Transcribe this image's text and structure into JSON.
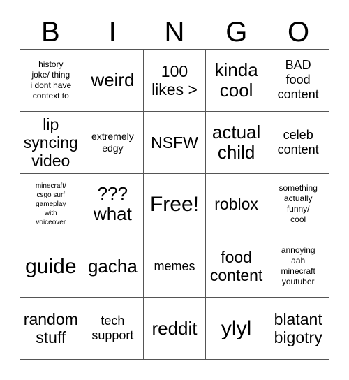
{
  "card": {
    "type": "bingo-card",
    "columns": 5,
    "rows": 5,
    "background_color": "#ffffff",
    "text_color": "#000000",
    "border_color": "#555555",
    "header": {
      "letters": [
        "B",
        "I",
        "N",
        "G",
        "O"
      ]
    },
    "free_space": {
      "label": "Free!",
      "row": 3,
      "column": 3
    },
    "cells": [
      [
        {
          "text": "history\njoke/ thing\ni dont have\ncontext to",
          "size": "fs-xs"
        },
        {
          "text": "weird",
          "size": "fs-xl"
        },
        {
          "text": "100\nlikes >",
          "size": "fs-lg"
        },
        {
          "text": "kinda\ncool",
          "size": "fs-xl"
        },
        {
          "text": "BAD\nfood\ncontent",
          "size": "fs-md"
        }
      ],
      [
        {
          "text": "lip\nsyncing\nvideo",
          "size": "fs-lg"
        },
        {
          "text": "extremely\nedgy",
          "size": "fs-sm"
        },
        {
          "text": "NSFW",
          "size": "fs-lg"
        },
        {
          "text": "actual\nchild",
          "size": "fs-xl"
        },
        {
          "text": "celeb\ncontent",
          "size": "fs-md"
        }
      ],
      [
        {
          "text": "minecraft/\ncsgo surf\ngameplay\nwith\nvoiceover",
          "size": "fs-xxs"
        },
        {
          "text": "???\nwhat",
          "size": "fs-xl"
        },
        {
          "text": "Free!",
          "size": "fs-xxl"
        },
        {
          "text": "roblox",
          "size": "fs-lg"
        },
        {
          "text": "something\nactually\nfunny/\ncool",
          "size": "fs-xs"
        }
      ],
      [
        {
          "text": "guide",
          "size": "fs-xxl"
        },
        {
          "text": "gacha",
          "size": "fs-xl"
        },
        {
          "text": "memes",
          "size": "fs-md"
        },
        {
          "text": "food\ncontent",
          "size": "fs-lg"
        },
        {
          "text": "annoying\naah\nminecraft\nyoutuber",
          "size": "fs-xs"
        }
      ],
      [
        {
          "text": "random\nstuff",
          "size": "fs-lg"
        },
        {
          "text": "tech\nsupport",
          "size": "fs-md"
        },
        {
          "text": "reddit",
          "size": "fs-xl"
        },
        {
          "text": "ylyl",
          "size": "fs-xxl"
        },
        {
          "text": "blatant\nbigotry",
          "size": "fs-lg"
        }
      ]
    ]
  }
}
